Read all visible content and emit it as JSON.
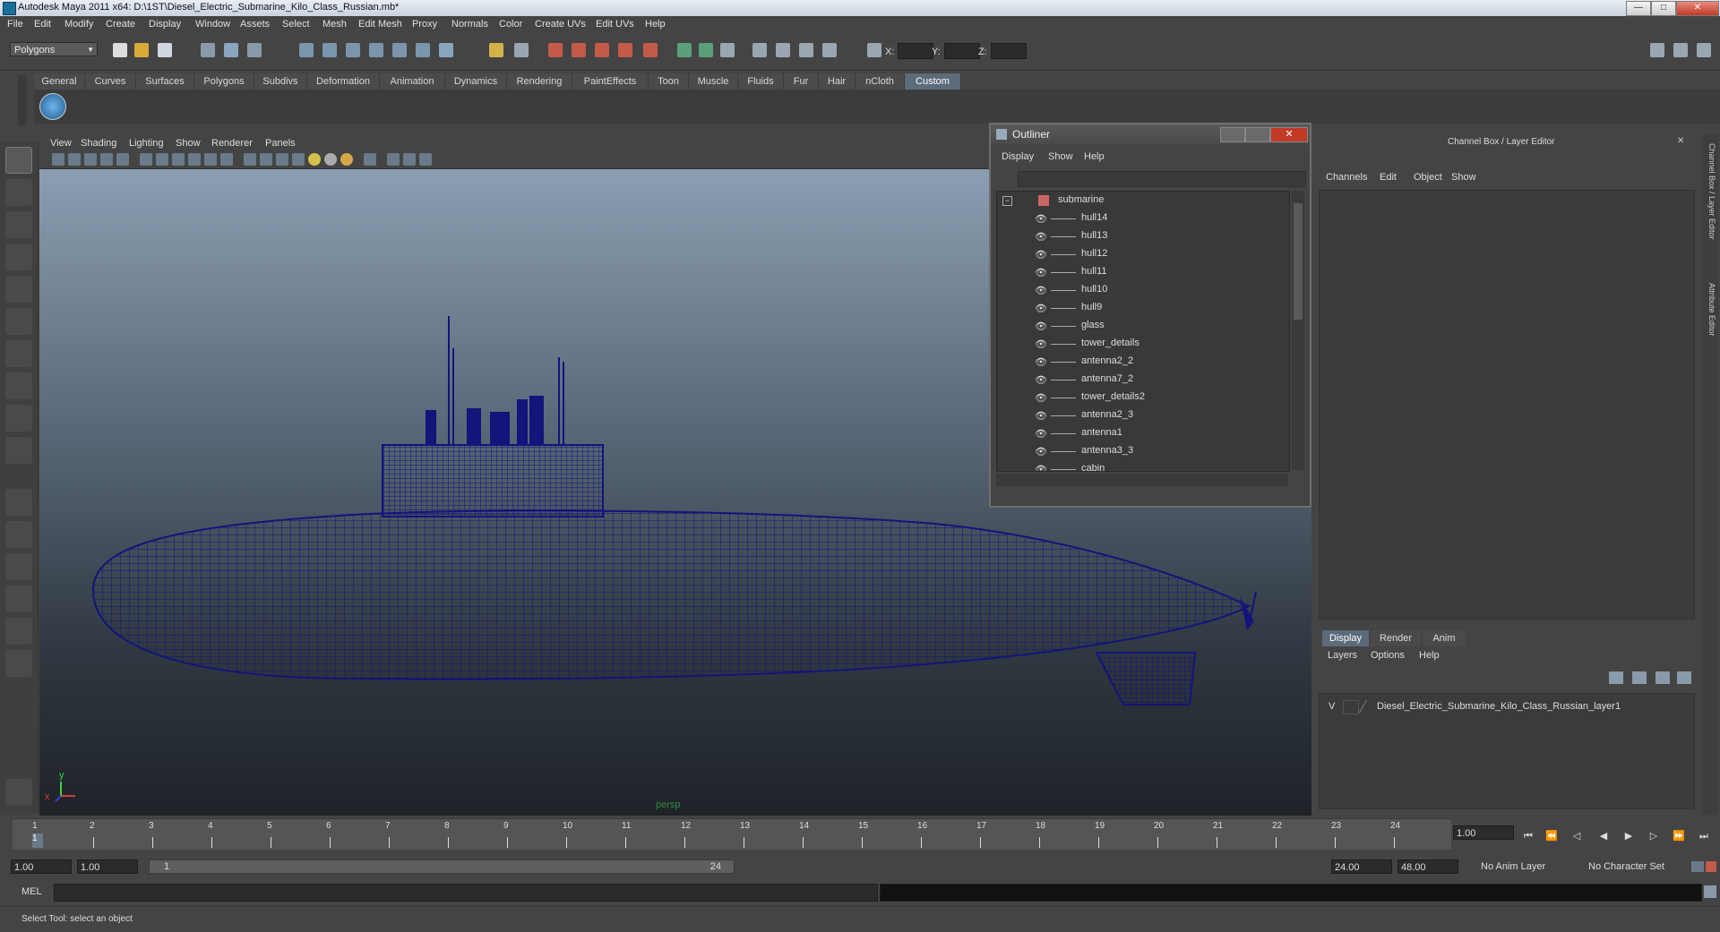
{
  "window": {
    "title": "Autodesk Maya 2011 x64: D:\\1ST\\Diesel_Electric_Submarine_Kilo_Class_Russian.mb*",
    "buttons": [
      "—",
      "□",
      "✕"
    ]
  },
  "menubar": [
    "File",
    "Edit",
    "Modify",
    "Create",
    "Display",
    "Window",
    "Assets",
    "Select",
    "Mesh",
    "Edit Mesh",
    "Proxy",
    "Normals",
    "Color",
    "Create UVs",
    "Edit UVs",
    "Help"
  ],
  "statusline": {
    "mode": "Polygons",
    "coords": {
      "x_label": "X:",
      "y_label": "Y:",
      "z_label": "Z:"
    }
  },
  "shelf": {
    "tabs": [
      "General",
      "Curves",
      "Surfaces",
      "Polygons",
      "Subdivs",
      "Deformation",
      "Animation",
      "Dynamics",
      "Rendering",
      "PaintEffects",
      "Toon",
      "Muscle",
      "Fluids",
      "Fur",
      "Hair",
      "nCloth",
      "Custom"
    ],
    "active_tab": "Custom"
  },
  "viewport": {
    "menus": [
      "View",
      "Shading",
      "Lighting",
      "Show",
      "Renderer",
      "Panels"
    ],
    "camera_label": "persp",
    "axis_x": "x",
    "axis_y": "y"
  },
  "outliner": {
    "title": "Outliner",
    "menus": [
      "Display",
      "Show",
      "Help"
    ],
    "root": "submarine",
    "items": [
      "hull14",
      "hull13",
      "hull12",
      "hull11",
      "hull10",
      "hull9",
      "glass",
      "tower_details",
      "antenna2_2",
      "antenna7_2",
      "tower_details2",
      "antenna2_3",
      "antenna1",
      "antenna3_3",
      "cabin"
    ]
  },
  "channel_box": {
    "header": "Channel Box / Layer Editor",
    "menus": [
      "Channels",
      "Edit",
      "Object",
      "Show"
    ],
    "layer_tabs": [
      "Display",
      "Render",
      "Anim"
    ],
    "active_layer_tab": "Display",
    "layer_menus": [
      "Layers",
      "Options",
      "Help"
    ],
    "layers": [
      {
        "visible": "V",
        "name": "Diesel_Electric_Submarine_Kilo_Class_Russian_layer1"
      }
    ]
  },
  "side_tabs": [
    "Channel Box / Layer Editor",
    "Attribute Editor"
  ],
  "timeline": {
    "ticks": [
      "1",
      "2",
      "3",
      "4",
      "5",
      "6",
      "7",
      "8",
      "9",
      "10",
      "11",
      "12",
      "13",
      "14",
      "15",
      "16",
      "17",
      "18",
      "19",
      "20",
      "21",
      "22",
      "23",
      "24"
    ],
    "current_frame": "1",
    "current_time_field": "1.00"
  },
  "range": {
    "start": "1.00",
    "start2": "1.00",
    "range_start": "1",
    "range_end": "24",
    "end": "24.00",
    "end2": "48.00",
    "anim_layer": "No Anim Layer",
    "character_set": "No Character Set"
  },
  "command": {
    "label": "MEL"
  },
  "status": {
    "help_text": "Select Tool: select an object"
  },
  "colors": {
    "wireframe": "#14147a",
    "active_tab": "#5b6b7a",
    "persp_label": "#2e8a3e"
  }
}
